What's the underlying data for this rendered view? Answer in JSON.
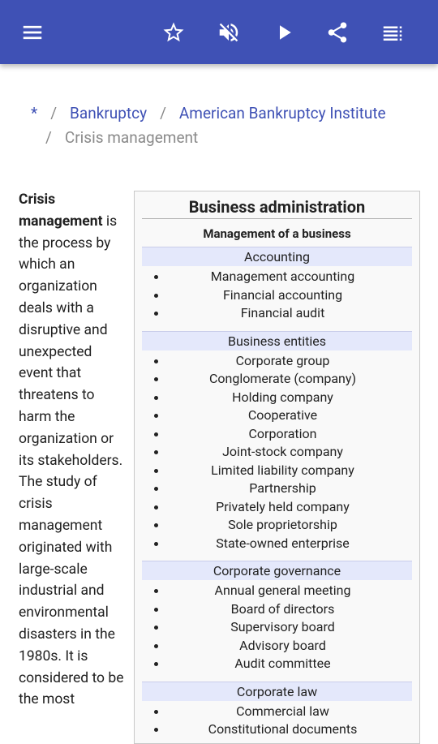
{
  "toolbar": {
    "menu_icon": "hamburger-menu-icon",
    "favorite_icon": "star-outline-icon",
    "mute_icon": "volume-off-icon",
    "play_icon": "play-icon",
    "share_icon": "share-icon",
    "contents_icon": "table-of-contents-icon",
    "background_color": "#3f51b5"
  },
  "breadcrumb": {
    "root": "*",
    "separator": "/",
    "item1": "Bankruptcy",
    "item2": "American Bankruptcy Institute",
    "current": "Crisis management"
  },
  "article": {
    "bold_term": "Crisis management",
    "text": "is the process by which an organization deals with a disruptive and unexpected event that threatens to harm the organization or its stakeholders. The study of crisis management originated with large-scale industrial and environmental disasters in the 1980s. It is considered to be the most"
  },
  "infobox": {
    "title": "Business administration",
    "subtitle": "Management of a business",
    "sections": [
      {
        "heading": "Accounting",
        "items": [
          "Management accounting",
          "Financial accounting",
          "Financial audit"
        ]
      },
      {
        "heading": "Business entities",
        "items": [
          "Corporate group",
          "Conglomerate (company)",
          "Holding company",
          "Cooperative",
          "Corporation",
          "Joint-stock company",
          "Limited liability company",
          "Partnership",
          "Privately held company",
          "Sole proprietorship",
          "State-owned enterprise"
        ]
      },
      {
        "heading": "Corporate governance",
        "items": [
          "Annual general meeting",
          "Board of directors",
          "Supervisory board",
          "Advisory board",
          "Audit committee"
        ]
      },
      {
        "heading": "Corporate law",
        "items": [
          "Commercial law",
          "Constitutional documents"
        ]
      }
    ]
  }
}
